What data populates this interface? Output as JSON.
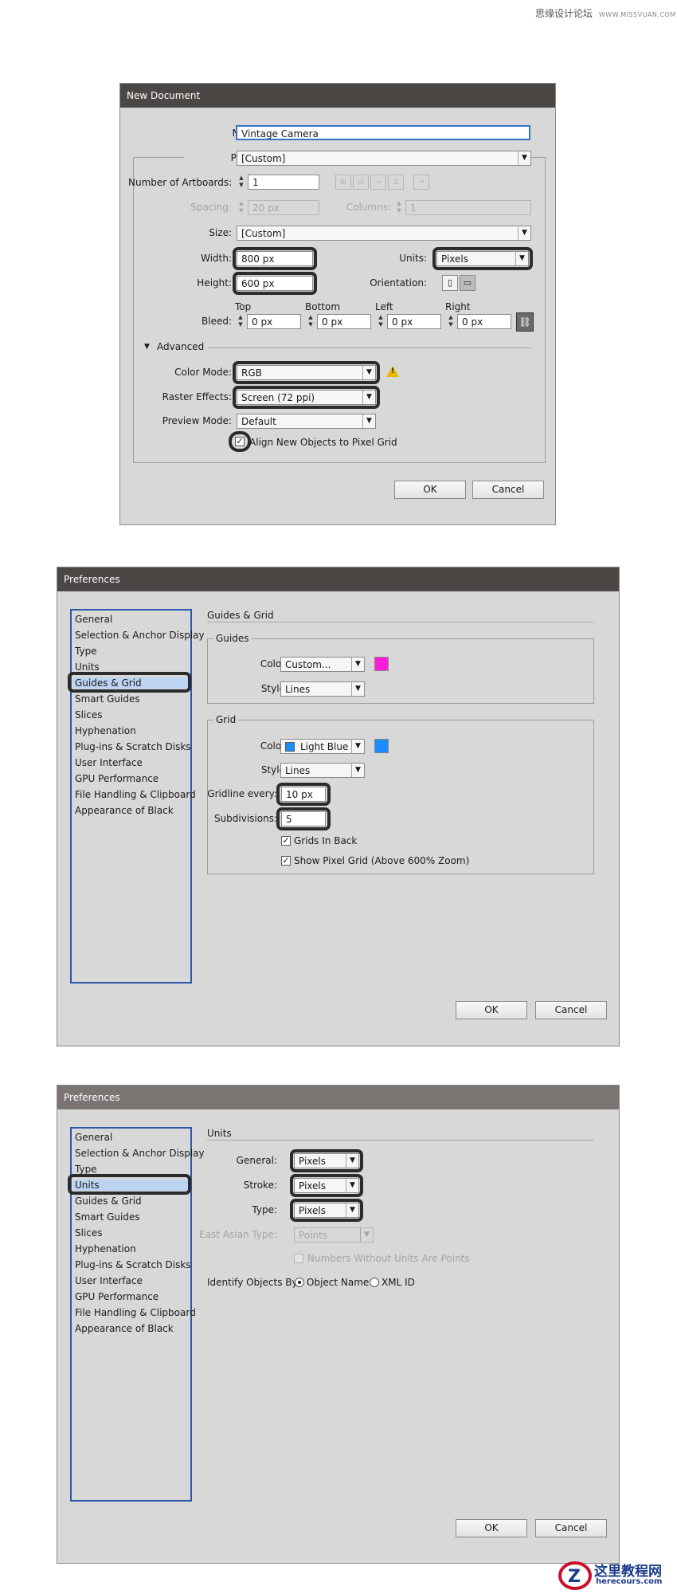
{
  "watermark_top": {
    "text": "思缘设计论坛",
    "url": "WWW.MISSVUAN.COM"
  },
  "watermark_bottom": {
    "cn": "这里教程网",
    "url": "herecours.com"
  },
  "new_document": {
    "title": "New Document",
    "name_label": "Name:",
    "name_value": "Vintage Camera",
    "profile_label": "Profile:",
    "profile_value": "[Custom]",
    "artboards_label": "Number of Artboards:",
    "artboards_value": "1",
    "spacing_label": "Spacing:",
    "spacing_value": "20 px",
    "columns_label": "Columns:",
    "columns_value": "1",
    "size_label": "Size:",
    "size_value": "[Custom]",
    "width_label": "Width:",
    "width_value": "800 px",
    "units_label": "Units:",
    "units_value": "Pixels",
    "height_label": "Height:",
    "height_value": "600 px",
    "orientation_label": "Orientation:",
    "bleed_label": "Bleed:",
    "bleed_top_label": "Top",
    "bleed_bottom_label": "Bottom",
    "bleed_left_label": "Left",
    "bleed_right_label": "Right",
    "bleed_top": "0 px",
    "bleed_bottom": "0 px",
    "bleed_left": "0 px",
    "bleed_right": "0 px",
    "advanced_label": "Advanced",
    "color_mode_label": "Color Mode:",
    "color_mode_value": "RGB",
    "raster_label": "Raster Effects:",
    "raster_value": "Screen (72 ppi)",
    "preview_label": "Preview Mode:",
    "preview_value": "Default",
    "align_label": "Align New Objects to Pixel Grid",
    "ok": "OK",
    "cancel": "Cancel"
  },
  "prefs_guides": {
    "title": "Preferences",
    "sidebar": [
      "General",
      "Selection & Anchor Display",
      "Type",
      "Units",
      "Guides & Grid",
      "Smart Guides",
      "Slices",
      "Hyphenation",
      "Plug-ins & Scratch Disks",
      "User Interface",
      "GPU Performance",
      "File Handling & Clipboard",
      "Appearance of Black"
    ],
    "section_title": "Guides & Grid",
    "guides_group": "Guides",
    "guides_color_label": "Color:",
    "guides_color_value": "Custom...",
    "guides_style_label": "Style:",
    "guides_style_value": "Lines",
    "grid_group": "Grid",
    "grid_color_label": "Color:",
    "grid_color_value": "Light Blue",
    "grid_style_label": "Style:",
    "grid_style_value": "Lines",
    "gridline_label": "Gridline every:",
    "gridline_value": "10 px",
    "subdiv_label": "Subdivisions:",
    "subdiv_value": "5",
    "grids_back_label": "Grids In Back",
    "pixel_grid_label": "Show Pixel Grid (Above 600% Zoom)",
    "ok": "OK",
    "cancel": "Cancel"
  },
  "prefs_units": {
    "title": "Preferences",
    "sidebar": [
      "General",
      "Selection & Anchor Display",
      "Type",
      "Units",
      "Guides & Grid",
      "Smart Guides",
      "Slices",
      "Hyphenation",
      "Plug-ins & Scratch Disks",
      "User Interface",
      "GPU Performance",
      "File Handling & Clipboard",
      "Appearance of Black"
    ],
    "section_title": "Units",
    "general_label": "General:",
    "general_value": "Pixels",
    "stroke_label": "Stroke:",
    "stroke_value": "Pixels",
    "type_label": "Type:",
    "type_value": "Pixels",
    "asian_label": "East Asian Type:",
    "asian_value": "Points",
    "numbers_label": "Numbers Without Units Are Points",
    "identify_label": "Identify Objects By:",
    "object_name": "Object Name",
    "xml_id": "XML ID",
    "ok": "OK",
    "cancel": "Cancel"
  },
  "colors": {
    "titlebar_dark": "#4a4745",
    "titlebar_light": "#7a7572",
    "dialog_bg": "#d8d8d8",
    "guides_color": "#ff1ed8",
    "grid_color": "#1a8cff",
    "highlight_ring": "#2b2b2b",
    "sidebar_border": "#2c56a8"
  }
}
